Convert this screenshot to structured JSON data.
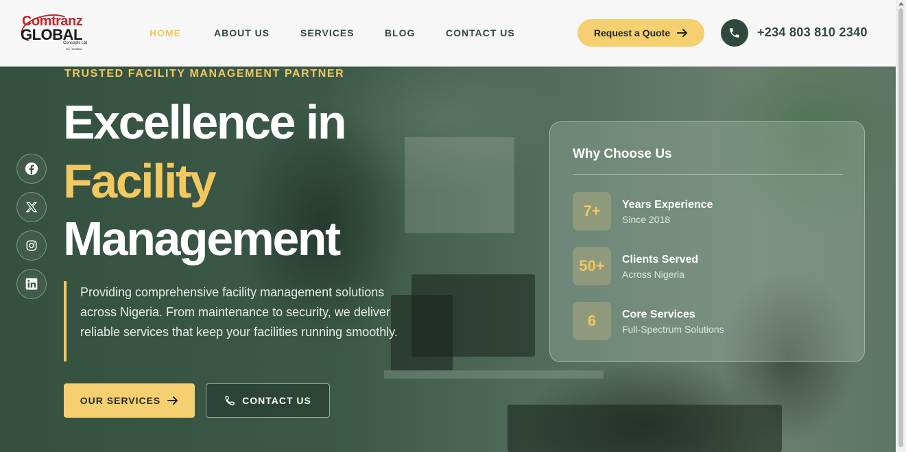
{
  "brand": {
    "logo_line1": "Comtranz",
    "logo_line2": "GLOBAL",
    "logo_line3": "Concepts Ltd",
    "logo_line4": "RC: 1525508"
  },
  "nav": {
    "items": [
      {
        "label": "HOME",
        "active": true
      },
      {
        "label": "ABOUT US",
        "active": false
      },
      {
        "label": "SERVICES",
        "active": false
      },
      {
        "label": "BLOG",
        "active": false
      },
      {
        "label": "CONTACT US",
        "active": false
      }
    ]
  },
  "header": {
    "quote_label": "Request a Quote",
    "phone": "+234 803 810 2340"
  },
  "social": [
    "facebook-icon",
    "x-icon",
    "instagram-icon",
    "linkedin-icon"
  ],
  "hero": {
    "eyebrow": "TRUSTED FACILITY MANAGEMENT PARTNER",
    "headline_line1": "Excellence in",
    "headline_line2": "Facility",
    "headline_line3": "Management",
    "description": "Providing comprehensive facility management solutions across Nigeria. From maintenance to security, we deliver reliable services that keep your facilities running smoothly.",
    "primary_button": "OUR SERVICES",
    "secondary_button": "CONTACT US"
  },
  "why": {
    "title": "Why Choose Us",
    "stats": [
      {
        "value": "7+",
        "label": "Years Experience",
        "sub": "Since 2018"
      },
      {
        "value": "50+",
        "label": "Clients Served",
        "sub": "Across Nigeria"
      },
      {
        "value": "6",
        "label": "Core Services",
        "sub": "Full-Spectrum Solutions"
      }
    ]
  },
  "colors": {
    "accent": "#f2c860",
    "primary": "#2f4a3c",
    "button": "#f5cf70"
  }
}
